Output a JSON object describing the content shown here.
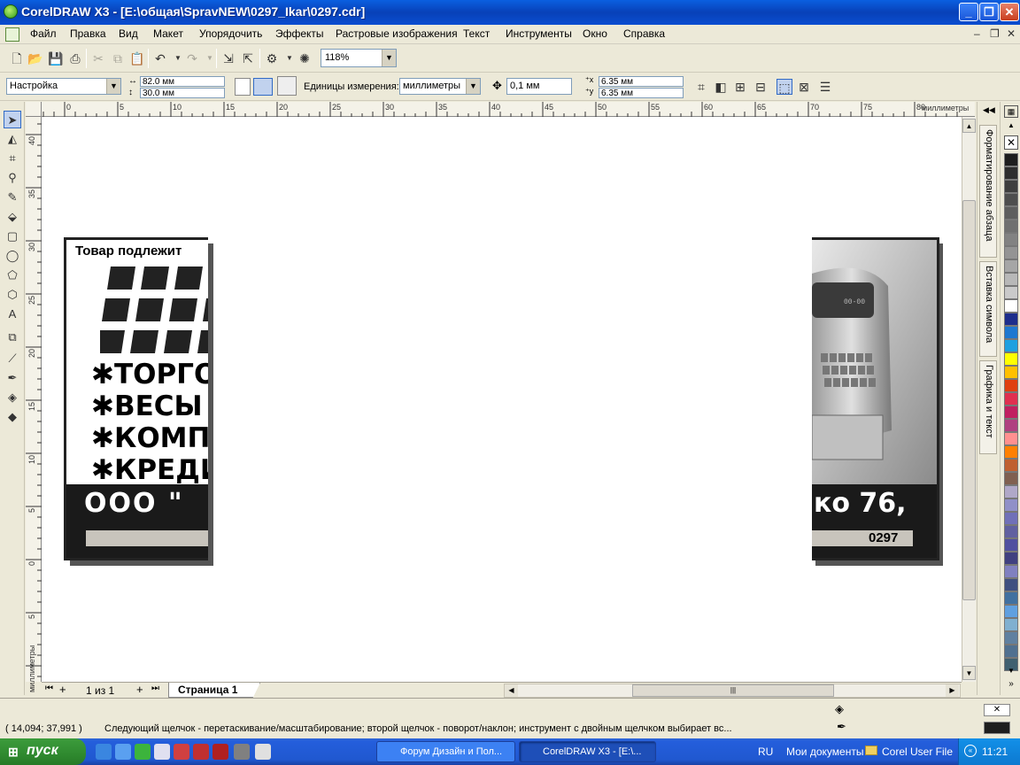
{
  "window": {
    "title": "CorelDRAW X3 - [E:\\общая\\SpravNEW\\0297_Ikar\\0297.cdr]",
    "min": "_",
    "max": "❐",
    "close": "✕"
  },
  "menu": {
    "items": [
      "Файл",
      "Правка",
      "Вид",
      "Макет",
      "Упорядочить",
      "Эффекты",
      "Растровые изображения",
      "Текст",
      "Инструменты",
      "Окно",
      "Справка"
    ],
    "doc_controls": [
      "–",
      "❐",
      "✕"
    ]
  },
  "toolbar": {
    "zoom": "118%"
  },
  "property_bar": {
    "preset": "Настройка",
    "width": "82.0 мм",
    "height": "30.0 мм",
    "units_label": "Единицы измерения:",
    "units_value": "миллиметры",
    "nudge": "0,1 мм",
    "dup_x": "6.35 мм",
    "dup_y": "6.35 мм"
  },
  "ruler": {
    "unit_label_h": "миллиметры",
    "unit_label_v": "миллиметры",
    "h_ticks": [
      "0",
      "5",
      "10",
      "15",
      "20",
      "25",
      "30",
      "35",
      "40",
      "45",
      "50",
      "55",
      "60",
      "65",
      "70",
      "75",
      "80"
    ],
    "v_ticks": [
      "40",
      "35",
      "30",
      "25",
      "20",
      "15",
      "10",
      "5",
      "0",
      "5"
    ]
  },
  "artwork": {
    "header_text": "Товар подлежит",
    "lines": [
      "ТОРГО",
      "ВЕСЫ",
      "КОМП",
      "КРЕДИ"
    ],
    "bottom_left": "ООО \"",
    "bottom_right": "ко 76,",
    "code": "0297",
    "display_digits": "00-00"
  },
  "pages": {
    "counter": "1 из 1",
    "tab": "Страница 1"
  },
  "dock": {
    "tabs": [
      "Форматирование абзаца",
      "Вставка символа",
      "Графика и текст"
    ]
  },
  "palette": {
    "colors": [
      "#1e1e1e",
      "#2e2e2e",
      "#3e3e3e",
      "#4e4e4e",
      "#5e5e5e",
      "#707070",
      "#828282",
      "#949494",
      "#a6a6a6",
      "#b8b8b8",
      "#cacaca",
      "#ffffff",
      "#1d2d8c",
      "#1e78d0",
      "#1ea0e0",
      "#ffff00",
      "#ffc000",
      "#e04010",
      "#e03050",
      "#c02060",
      "#b04080",
      "#ff9090",
      "#ff8000",
      "#c06030",
      "#806050",
      "#b0a8c8",
      "#9090c8",
      "#7070b8",
      "#6060a0",
      "#5050a0",
      "#404080",
      "#8080c0",
      "#405080",
      "#4070a0",
      "#60a0e0",
      "#80b0d0",
      "#6080a0",
      "#507090",
      "#406070"
    ]
  },
  "status": {
    "coords": "( 14,094; 37,991 )",
    "hint": "Следующий щелчок - перетаскивание/масштабирование; второй щелчок - поворот/наклон; инструмент с двойным щелчком выбирает вс..."
  },
  "taskbar": {
    "start": "пуск",
    "tasks": [
      "Форум Дизайн и Пол...",
      "CorelDRAW X3 - [E:\\..."
    ],
    "lang": "RU",
    "my_docs": "Мои документы",
    "folder": "Corel User File",
    "time": "11:21"
  }
}
